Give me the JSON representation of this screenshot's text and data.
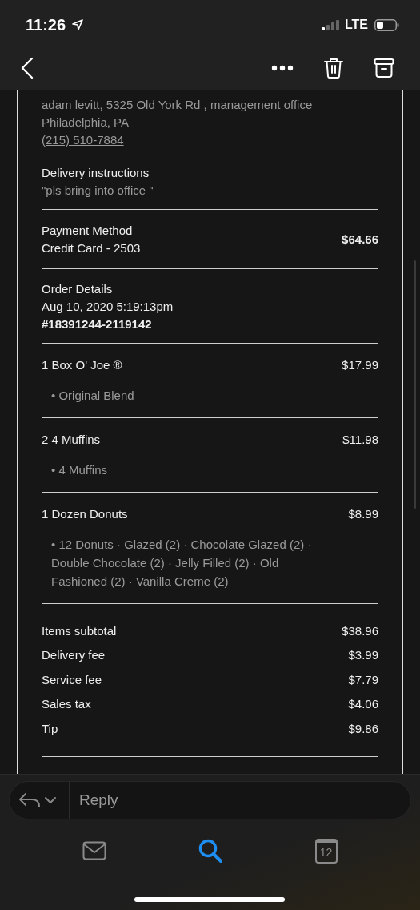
{
  "status_bar": {
    "time": "11:26",
    "network": "LTE"
  },
  "address": {
    "lines": [
      "adam levitt, 5325 Old York Rd , management office",
      "Philadelphia, PA"
    ],
    "phone": "(215) 510-7884"
  },
  "delivery_instructions": {
    "title": "Delivery instructions",
    "text": "\"pls bring into office \""
  },
  "payment": {
    "title": "Payment Method",
    "method": "Credit Card - 2503",
    "amount": "$64.66"
  },
  "order_details": {
    "title": "Order Details",
    "date": "Aug 10, 2020 5:19:13pm",
    "number": "#18391244-2119142"
  },
  "items": [
    {
      "name": "1 Box O' Joe ®",
      "price": "$17.99",
      "details": "• Original Blend"
    },
    {
      "name": "2 4 Muffins",
      "price": "$11.98",
      "details": "• 4 Muffins"
    },
    {
      "name": "1 Dozen Donuts",
      "price": "$8.99",
      "details": "• 12 Donuts · Glazed (2) · Chocolate Glazed (2) · Double Chocolate (2) · Jelly Filled (2) · Old Fashioned (2) · Vanilla Creme (2)"
    }
  ],
  "totals": [
    {
      "label": "Items subtotal",
      "value": "$38.96"
    },
    {
      "label": "Delivery fee",
      "value": "$3.99"
    },
    {
      "label": "Service fee",
      "value": "$7.79"
    },
    {
      "label": "Sales tax",
      "value": "$4.06"
    },
    {
      "label": "Tip",
      "value": "$9.86"
    }
  ],
  "reply": {
    "placeholder": "Reply"
  },
  "tabs": [
    {
      "kind": "mail",
      "selected": false
    },
    {
      "kind": "search",
      "selected": true
    },
    {
      "kind": "calendar",
      "selected": false,
      "label": "12"
    }
  ]
}
